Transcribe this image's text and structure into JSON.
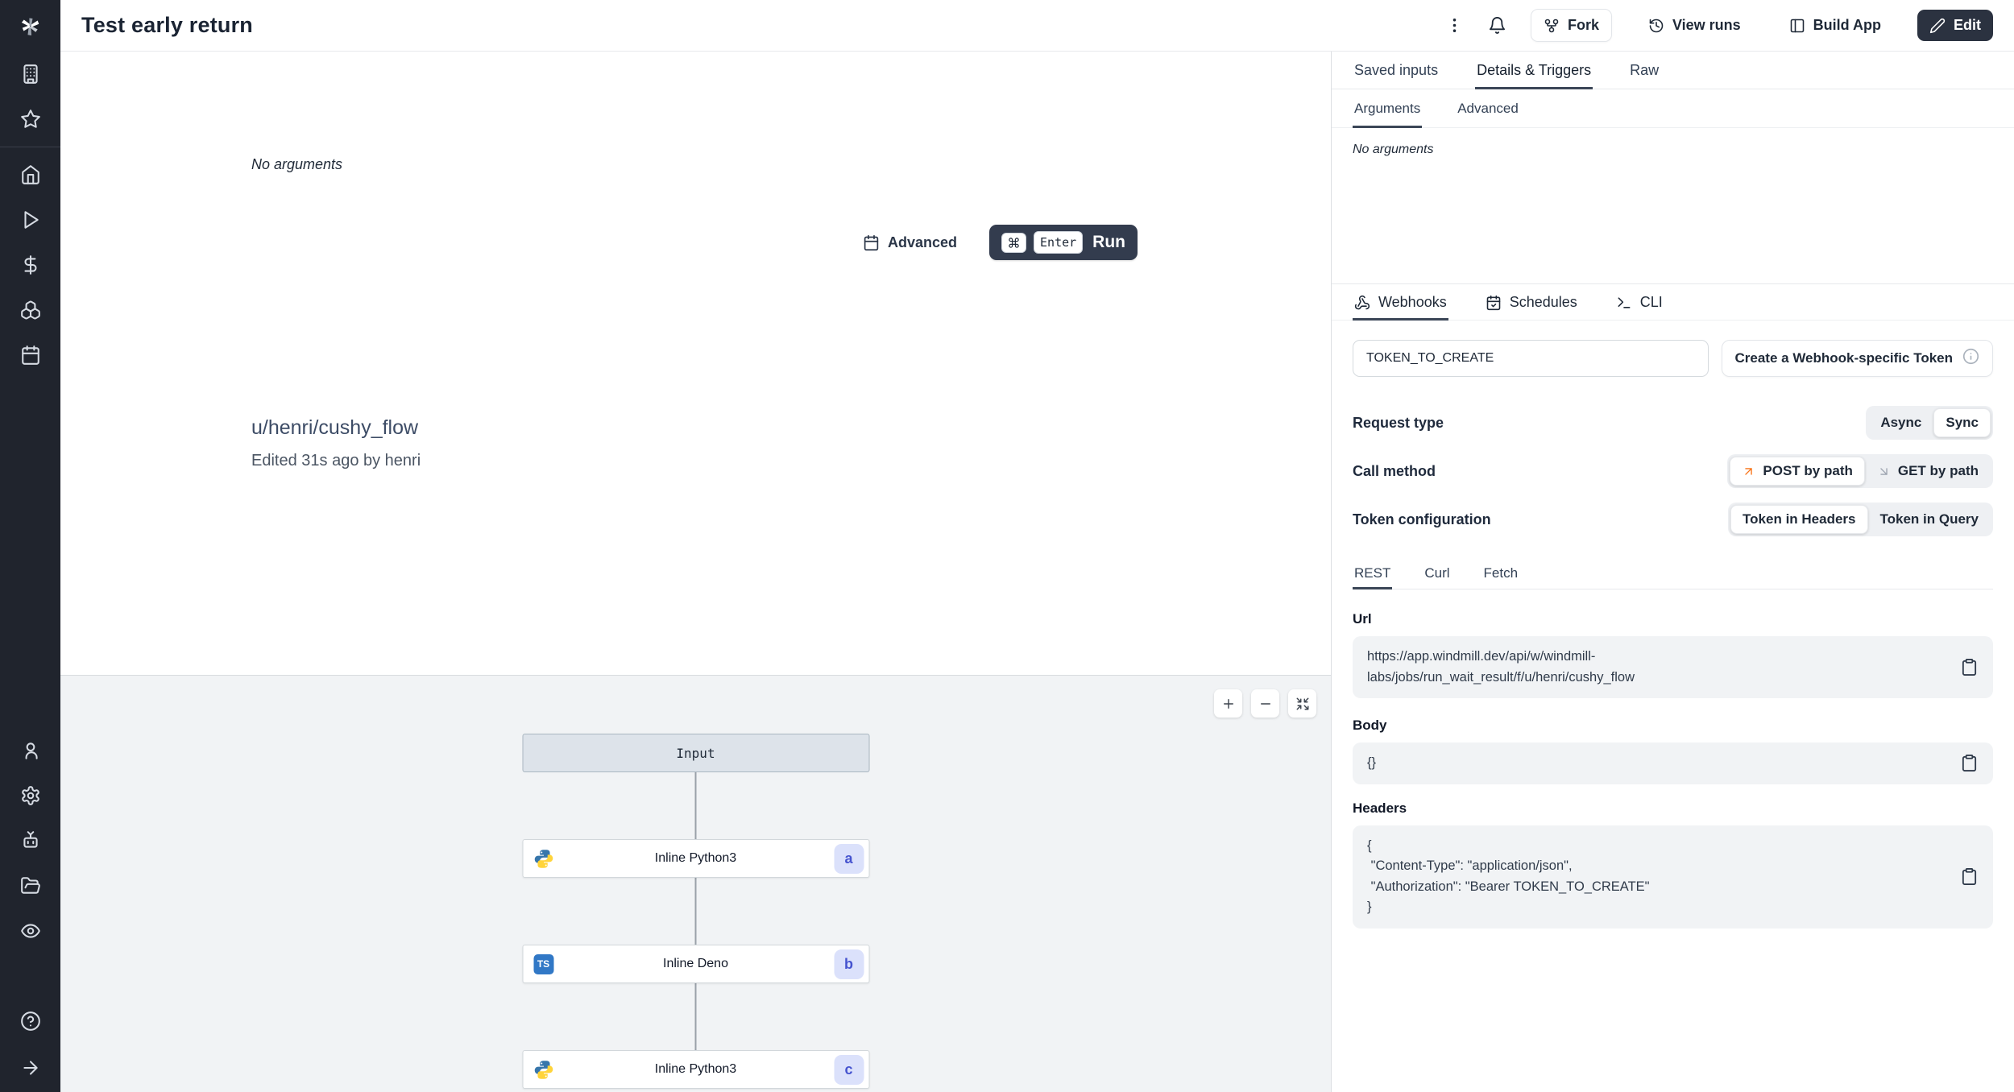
{
  "header": {
    "title": "Test early return",
    "fork_label": "Fork",
    "view_runs_label": "View runs",
    "build_app_label": "Build App",
    "edit_label": "Edit"
  },
  "sidebar": {
    "icons": [
      "windmill-logo",
      "building",
      "star",
      "home",
      "play",
      "dollar",
      "boxes",
      "calendar",
      "user",
      "gear",
      "bot",
      "folder-open",
      "eye",
      "help-circle",
      "arrow-right"
    ]
  },
  "main": {
    "no_arguments": "No arguments",
    "advanced_label": "Advanced",
    "enter_key": "Enter",
    "run_label": "Run",
    "flow_path": "u/henri/cushy_flow",
    "edited_info": "Edited 31s ago by henri"
  },
  "graph": {
    "input_label": "Input",
    "nodes": [
      {
        "label": "Inline Python3",
        "badge": "a",
        "lang": "python"
      },
      {
        "label": "Inline Deno",
        "badge": "b",
        "lang": "typescript"
      },
      {
        "label": "Inline Python3",
        "badge": "c",
        "lang": "python"
      }
    ],
    "ts_icon_text": "TS"
  },
  "panel": {
    "tabs": {
      "saved_inputs": "Saved inputs",
      "details_triggers": "Details & Triggers",
      "raw": "Raw",
      "active": "Details & Triggers"
    },
    "subtabs": {
      "arguments": "Arguments",
      "advanced": "Advanced",
      "active": "Arguments"
    },
    "no_arguments": "No arguments",
    "trigger_tabs": {
      "webhooks": "Webhooks",
      "schedules": "Schedules",
      "cli": "CLI",
      "active": "Webhooks"
    },
    "token_input_value": "TOKEN_TO_CREATE",
    "create_token_label": "Create a Webhook-specific Token",
    "request_type": {
      "label": "Request type",
      "async": "Async",
      "sync": "Sync",
      "selected": "Sync"
    },
    "call_method": {
      "label": "Call method",
      "post": "POST by path",
      "get": "GET by path",
      "selected": "POST by path"
    },
    "token_config": {
      "label": "Token configuration",
      "headers": "Token in Headers",
      "query": "Token in Query",
      "selected": "Token in Headers"
    },
    "code_tabs": {
      "rest": "REST",
      "curl": "Curl",
      "fetch": "Fetch",
      "active": "REST"
    },
    "url": {
      "label": "Url",
      "value": "https://app.windmill.dev/api/w/windmill-labs/jobs/run_wait_result/f/u/henri/cushy_flow",
      "line1": "https://app.windmill.dev/api/w/windmill-",
      "line2": "labs/jobs/run_wait_result/f/u/henri/cushy_flow"
    },
    "body": {
      "label": "Body",
      "value": "{}"
    },
    "headers": {
      "label": "Headers",
      "value": "{\n \"Content-Type\": \"application/json\",\n \"Authorization\": \"Bearer TOKEN_TO_CREATE\"\n}"
    }
  },
  "colors": {
    "sidebar_bg": "#20242d",
    "dark_button": "#333c4e",
    "edit_button": "#2b3240",
    "graph_bg": "#f1f3f5",
    "badge_bg": "#dbe1fb",
    "badge_text": "#4553cf",
    "post_arrow": "#f97316",
    "active_underline": "#3b4657"
  }
}
